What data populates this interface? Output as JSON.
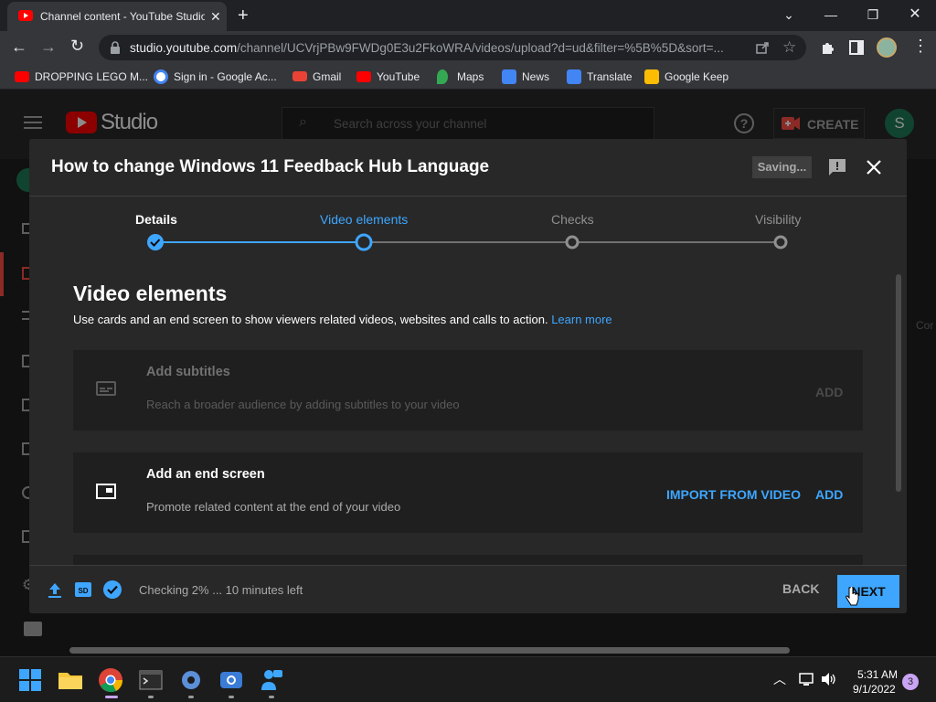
{
  "browser": {
    "tab_title": "Channel content - YouTube Studio",
    "url_domain": "studio.youtube.com",
    "url_path": "/channel/UCVrjPBw9FWDg0E3u2FkoWRA/videos/upload?d=ud&filter=%5B%5D&sort=...",
    "bookmarks": [
      {
        "label": "DROPPING LEGO M...",
        "icon": "youtube-icon",
        "color": "#ff0000"
      },
      {
        "label": "Sign in - Google Ac...",
        "icon": "google-icon",
        "color": "#4285f4"
      },
      {
        "label": "Gmail",
        "icon": "gmail-icon",
        "color": "#ea4335"
      },
      {
        "label": "YouTube",
        "icon": "youtube-icon",
        "color": "#ff0000"
      },
      {
        "label": "Maps",
        "icon": "maps-icon",
        "color": "#34a853"
      },
      {
        "label": "News",
        "icon": "news-icon",
        "color": "#4285f4"
      },
      {
        "label": "Translate",
        "icon": "translate-icon",
        "color": "#4285f4"
      },
      {
        "label": "Google Keep",
        "icon": "keep-icon",
        "color": "#fbbc04"
      }
    ]
  },
  "studio": {
    "logo_text": "Studio",
    "search_placeholder": "Search across your channel",
    "create_label": "CREATE",
    "avatar_letter": "S",
    "side_cut_text": "Cor"
  },
  "dialog": {
    "title": "How to change Windows 11 Feedback Hub Language",
    "saving_label": "Saving...",
    "steps": [
      {
        "label": "Details",
        "state": "done"
      },
      {
        "label": "Video elements",
        "state": "current"
      },
      {
        "label": "Checks",
        "state": "pending"
      },
      {
        "label": "Visibility",
        "state": "pending"
      }
    ],
    "section_title": "Video elements",
    "section_desc": "Use cards and an end screen to show viewers related videos, websites and calls to action.",
    "learn_more": "Learn more",
    "cards": [
      {
        "title": "Add subtitles",
        "desc": "Reach a broader audience by adding subtitles to your video",
        "action": "ADD",
        "enabled": false,
        "icon": "subtitles-icon"
      },
      {
        "title": "Add an end screen",
        "desc": "Promote related content at the end of your video",
        "import_action": "IMPORT FROM VIDEO",
        "action": "ADD",
        "enabled": true,
        "icon": "end-screen-icon"
      }
    ],
    "status_text": "Checking 2% ... 10 minutes left",
    "back_label": "BACK",
    "next_label": "NEXT"
  },
  "colors": {
    "accent": "#3ea6ff",
    "youtube_red": "#ff0000",
    "dialog_bg": "#282828",
    "card_bg": "#1f1f1f"
  },
  "taskbar": {
    "apps": [
      "windows-start-icon",
      "file-explorer-icon",
      "chrome-icon",
      "terminal-icon",
      "settings-icon",
      "camera-app-icon",
      "feedback-hub-icon"
    ],
    "time": "5:31 AM",
    "date": "9/1/2022",
    "notification_count": "3"
  }
}
